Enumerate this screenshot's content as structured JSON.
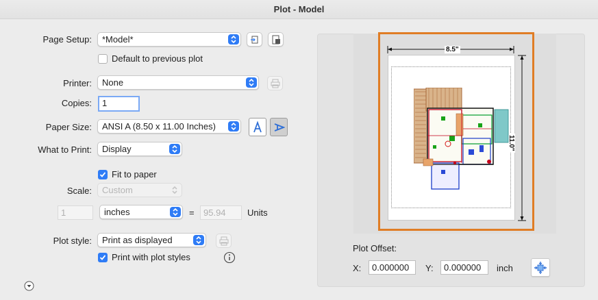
{
  "window": {
    "title": "Plot - Model"
  },
  "page_setup": {
    "label": "Page Setup:",
    "value": "*Model*"
  },
  "default_prev": {
    "label": "Default to previous plot",
    "checked": false
  },
  "printer": {
    "label": "Printer:",
    "value": "None"
  },
  "copies": {
    "label": "Copies:",
    "value": "1"
  },
  "paper_size": {
    "label": "Paper Size:",
    "value": "ANSI A (8.50 x 11.00 Inches)"
  },
  "what_to_print": {
    "label": "What to Print:",
    "value": "Display"
  },
  "fit_to_paper": {
    "label": "Fit to paper",
    "checked": true
  },
  "scale": {
    "label": "Scale:",
    "value": "Custom",
    "left_value": "1",
    "unit": "inches",
    "equals": "=",
    "right_value": "95.94",
    "units_label": "Units"
  },
  "plot_style": {
    "label": "Plot style:",
    "value": "Print as displayed"
  },
  "print_with_styles": {
    "label": "Print with plot styles",
    "checked": true
  },
  "preview": {
    "width_label": "8.5\"",
    "height_label": "11.0\""
  },
  "plot_offset": {
    "label": "Plot Offset:",
    "x_label": "X:",
    "x_value": "0.000000",
    "y_label": "Y:",
    "y_value": "0.000000",
    "unit": "inch"
  },
  "colors": {
    "accent": "#2f7cf6",
    "highlight": "#e07d25"
  }
}
